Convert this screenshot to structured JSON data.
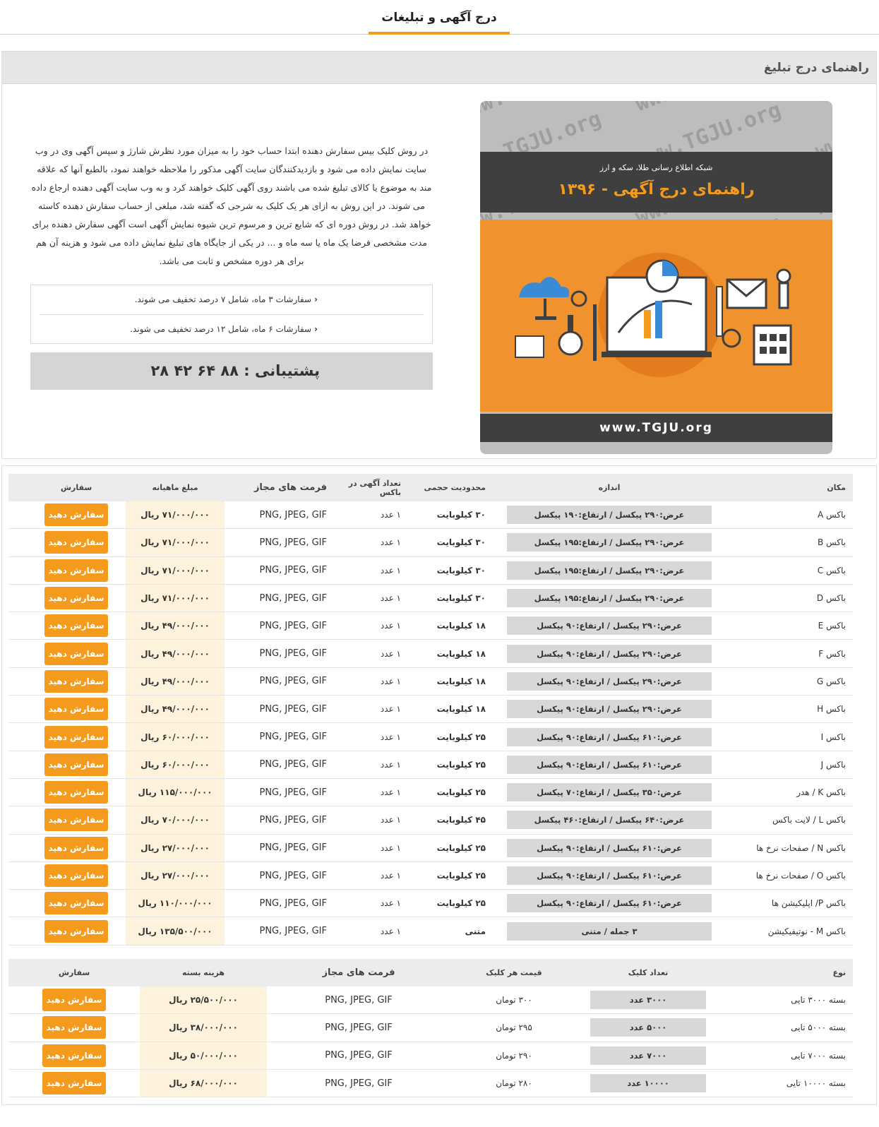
{
  "tab_title": "درج آگهی و تبلیغات",
  "section_title": "راهنمای درج تبلیغ",
  "banner": {
    "subtitle": "شبکه اطلاع رسانی طلا، سکه و ارز",
    "title": "راهنمای درج آگهی - ۱۳۹۶",
    "footer": "www.TGJU.org",
    "watermark": "www.TGJU.org"
  },
  "guide_text": "در روش کلیک بیس سفارش دهنده ابتدا حساب خود را به میزان مورد نظرش شارژ و سپس آگهی وی در وب سایت نمایش داده می شود و بازدیدکنندگان سایت آگهی مذکور را ملاحظه خواهند نمود، بالطبع آنها که علاقه مند به موضوع یا کالای تبلیغ شده می باشند روی آگهی کلیک خواهند کرد و به وب سایت آگهی دهنده ارجاع داده می شوند. در این روش به ازای هر یک کلیک به شرحی که گفته شد، مبلغی از حساب سفارش دهنده کاسته خواهد شد. در روش دوره ای که شایع ترین و مرسوم ترین شیوه نمایش آگهی است آگهی سفارش دهنده برای مدت مشخصی فرضا یک ماه یا سه ماه و ... در یکی از جایگاه های تبلیغ نمایش داده می شود و هزینه آن هم برای هر دوره مشخص و ثابت می باشد.",
  "discounts": [
    "سفارشات ۳ ماه، شامل ۷ درصد تخفیف می شوند.",
    "سفارشات ۶ ماه، شامل ۱۲ درصد تخفیف می شوند."
  ],
  "support": "پشتیبانی : ۸۸ ۶۴ ۴۲ ۲۸",
  "table1": {
    "headers": {
      "location": "مکان",
      "size": "اندازه",
      "limit": "محدودیت حجمی",
      "count": "تعداد آگهی در باکس",
      "formats": "فرمت های مجاز",
      "price": "مبلغ ماهیانه",
      "order": "سفارش"
    },
    "rows": [
      {
        "location": "باکس A",
        "size": "عرض:۲۹۰ پیکسل / ارتفاع:۱۹۰ پیکسل",
        "limit": "۳۰ کیلوبایت",
        "count": "۱ عدد",
        "formats": "PNG, JPEG, GIF",
        "price": "۷۱/۰۰۰/۰۰۰ ریال",
        "order": "سفارش دهید"
      },
      {
        "location": "باکس B",
        "size": "عرض:۲۹۰ پیکسل / ارتفاع:۱۹۵ پیکسل",
        "limit": "۳۰ کیلوبایت",
        "count": "۱ عدد",
        "formats": "PNG, JPEG, GIF",
        "price": "۷۱/۰۰۰/۰۰۰ ریال",
        "order": "سفارش دهید"
      },
      {
        "location": "باکس C",
        "size": "عرض:۲۹۰ پیکسل / ارتفاع:۱۹۵ پیکسل",
        "limit": "۳۰ کیلوبایت",
        "count": "۱ عدد",
        "formats": "PNG, JPEG, GIF",
        "price": "۷۱/۰۰۰/۰۰۰ ریال",
        "order": "سفارش دهید"
      },
      {
        "location": "باکس D",
        "size": "عرض:۲۹۰ پیکسل / ارتفاع:۱۹۵ پیکسل",
        "limit": "۳۰ کیلوبایت",
        "count": "۱ عدد",
        "formats": "PNG, JPEG, GIF",
        "price": "۷۱/۰۰۰/۰۰۰ ریال",
        "order": "سفارش دهید"
      },
      {
        "location": "باکس E",
        "size": "عرض:۲۹۰ پیکسل / ارتفاع:۹۰ پیکسل",
        "limit": "۱۸ کیلوبایت",
        "count": "۱ عدد",
        "formats": "PNG, JPEG, GIF",
        "price": "۴۹/۰۰۰/۰۰۰ ریال",
        "order": "سفارش دهید"
      },
      {
        "location": "باکس F",
        "size": "عرض:۲۹۰ پیکسل / ارتفاع:۹۰ پیکسل",
        "limit": "۱۸ کیلوبایت",
        "count": "۱ عدد",
        "formats": "PNG, JPEG, GIF",
        "price": "۴۹/۰۰۰/۰۰۰ ریال",
        "order": "سفارش دهید"
      },
      {
        "location": "باکس G",
        "size": "عرض:۲۹۰ پیکسل / ارتفاع:۹۰ پیکسل",
        "limit": "۱۸ کیلوبایت",
        "count": "۱ عدد",
        "formats": "PNG, JPEG, GIF",
        "price": "۴۹/۰۰۰/۰۰۰ ریال",
        "order": "سفارش دهید"
      },
      {
        "location": "باکس H",
        "size": "عرض:۲۹۰ پیکسل / ارتفاع:۹۰ پیکسل",
        "limit": "۱۸ کیلوبایت",
        "count": "۱ عدد",
        "formats": "PNG, JPEG, GIF",
        "price": "۴۹/۰۰۰/۰۰۰ ریال",
        "order": "سفارش دهید"
      },
      {
        "location": "باکس I",
        "size": "عرض:۶۱۰ پیکسل / ارتفاع:۹۰ پیکسل",
        "limit": "۲۵ کیلوبایت",
        "count": "۱ عدد",
        "formats": "PNG, JPEG, GIF",
        "price": "۶۰/۰۰۰/۰۰۰ ریال",
        "order": "سفارش دهید"
      },
      {
        "location": "باکس J",
        "size": "عرض:۶۱۰ پیکسل / ارتفاع:۹۰ پیکسل",
        "limit": "۲۵ کیلوبایت",
        "count": "۱ عدد",
        "formats": "PNG, JPEG, GIF",
        "price": "۶۰/۰۰۰/۰۰۰ ریال",
        "order": "سفارش دهید"
      },
      {
        "location": "باکس K / هدر",
        "size": "عرض:۳۵۰ پیکسل / ارتفاع:۷۰ پیکسل",
        "limit": "۲۵ کیلوبایت",
        "count": "۱ عدد",
        "formats": "PNG, JPEG, GIF",
        "price": "۱۱۵/۰۰۰/۰۰۰ ریال",
        "order": "سفارش دهید"
      },
      {
        "location": "باکس L / لایت باکس",
        "size": "عرض:۶۴۰ پیکسل / ارتفاع:۴۶۰ پیکسل",
        "limit": "۴۵ کیلوبایت",
        "count": "۱ عدد",
        "formats": "PNG, JPEG, GIF",
        "price": "۷۰/۰۰۰/۰۰۰ ریال",
        "order": "سفارش دهید"
      },
      {
        "location": "باکس N / صفحات نرخ ها",
        "size": "عرض:۶۱۰ پیکسل / ارتفاع:۹۰ پیکسل",
        "limit": "۲۵ کیلوبایت",
        "count": "۱ عدد",
        "formats": "PNG, JPEG, GIF",
        "price": "۲۷/۰۰۰/۰۰۰ ریال",
        "order": "سفارش دهید"
      },
      {
        "location": "باکس O / صفحات نرخ ها",
        "size": "عرض:۶۱۰ پیکسل / ارتفاع:۹۰ پیکسل",
        "limit": "۲۵ کیلوبایت",
        "count": "۱ عدد",
        "formats": "PNG, JPEG, GIF",
        "price": "۲۷/۰۰۰/۰۰۰ ریال",
        "order": "سفارش دهید"
      },
      {
        "location": "باکس P/ اپلیکیشن ها",
        "size": "عرض:۶۱۰ پیکسل / ارتفاع:۹۰ پیکسل",
        "limit": "۲۵ کیلوبایت",
        "count": "۱ عدد",
        "formats": "PNG, JPEG, GIF",
        "price": "۱۱۰/۰۰۰/۰۰۰ ریال",
        "order": "سفارش دهید"
      },
      {
        "location": "باکس M - نوتیفیکیشن",
        "size": "۳ جمله / متنی",
        "limit": "متنی",
        "count": "۱ عدد",
        "formats": "PNG, JPEG, GIF",
        "price": "۱۳۵/۵۰۰/۰۰۰ ریال",
        "order": "سفارش دهید"
      }
    ]
  },
  "table2": {
    "headers": {
      "type": "نوع",
      "clicks": "تعداد کلیک",
      "ppc": "قیمت هر کلیک",
      "formats": "فرمت های مجاز",
      "cost": "هزینه بسته",
      "order": "سفارش"
    },
    "rows": [
      {
        "type": "بسته ۳۰۰۰ تایی",
        "clicks": "۳۰۰۰ عدد",
        "ppc": "۳۰۰ تومان",
        "formats": "PNG, JPEG, GIF",
        "cost": "۲۵/۵۰۰/۰۰۰ ریال",
        "order": "سفارش دهید"
      },
      {
        "type": "بسته ۵۰۰۰ تایی",
        "clicks": "۵۰۰۰ عدد",
        "ppc": "۲۹۵ تومان",
        "formats": "PNG, JPEG, GIF",
        "cost": "۳۸/۰۰۰/۰۰۰ ریال",
        "order": "سفارش دهید"
      },
      {
        "type": "بسته ۷۰۰۰ تایی",
        "clicks": "۷۰۰۰ عدد",
        "ppc": "۲۹۰ تومان",
        "formats": "PNG, JPEG, GIF",
        "cost": "۵۰/۰۰۰/۰۰۰ ریال",
        "order": "سفارش دهید"
      },
      {
        "type": "بسته ۱۰۰۰۰ تایی",
        "clicks": "۱۰۰۰۰ عدد",
        "ppc": "۲۸۰ تومان",
        "formats": "PNG, JPEG, GIF",
        "cost": "۶۸/۰۰۰/۰۰۰ ریال",
        "order": "سفارش دهید"
      }
    ]
  },
  "colors": {
    "accent": "#f49a1d",
    "price_bg": "#fff2dc",
    "header_bg": "#ececec"
  }
}
